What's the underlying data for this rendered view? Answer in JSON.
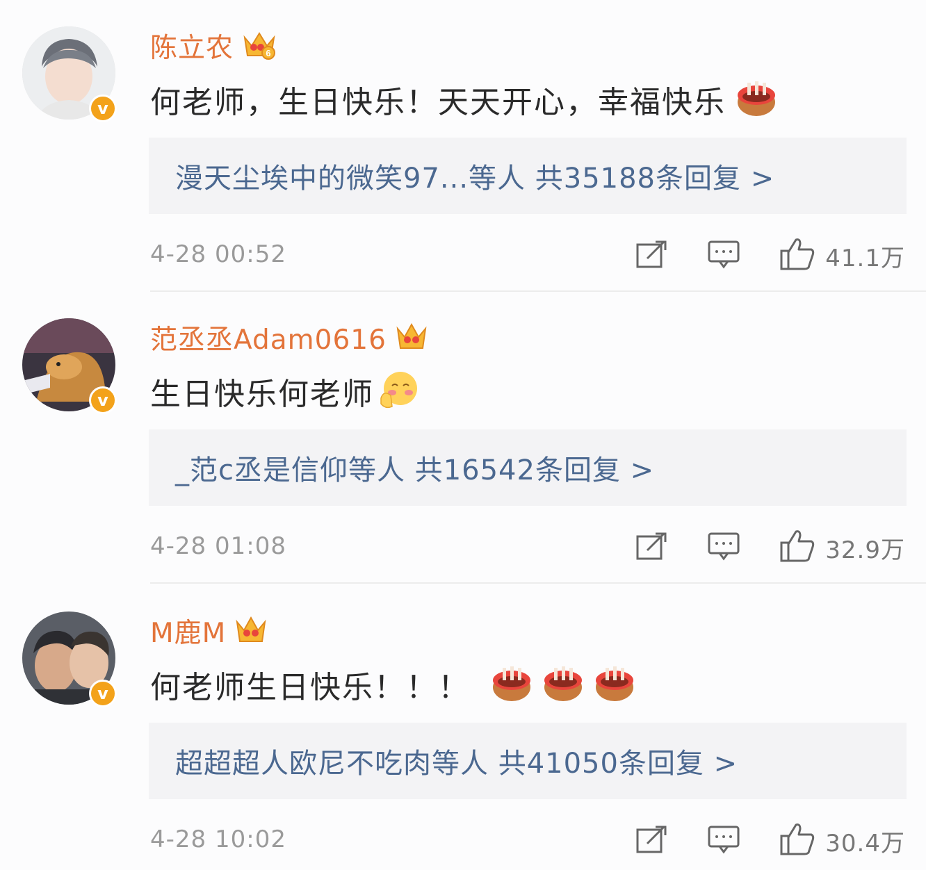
{
  "comments": [
    {
      "username": "陈立农",
      "text": "何老师，生日快乐！天天开心，幸福快乐",
      "emojis": [
        "birthday-cake-icon"
      ],
      "reply_summary": "漫天尘埃中的微笑97...等人  共35188条回复 >",
      "time": "4-28 00:52",
      "likes": "41.1万",
      "crown_level": "6",
      "verified_badge": "v"
    },
    {
      "username": "范丞丞Adam0616",
      "text": "生日快乐何老师",
      "emojis": [
        "shy-face-icon"
      ],
      "reply_summary": "_范c丞是信仰等人  共16542条回复 >",
      "time": "4-28 01:08",
      "likes": "32.9万",
      "crown_level": "",
      "verified_badge": "v"
    },
    {
      "username": "M鹿M",
      "text": "何老师生日快乐！！！",
      "emojis": [
        "birthday-cake-icon",
        "birthday-cake-icon",
        "birthday-cake-icon"
      ],
      "reply_summary": "超超超人欧尼不吃肉等人  共41050条回复 >",
      "time": "4-28 10:02",
      "likes": "30.4万",
      "crown_level": "",
      "verified_badge": "v"
    }
  ],
  "colors": {
    "username": "#e3743a",
    "reply_link": "#4b6890",
    "reply_bg": "#f3f3f5",
    "meta_text": "#9a9a9a",
    "verified": "#f3a21a"
  }
}
